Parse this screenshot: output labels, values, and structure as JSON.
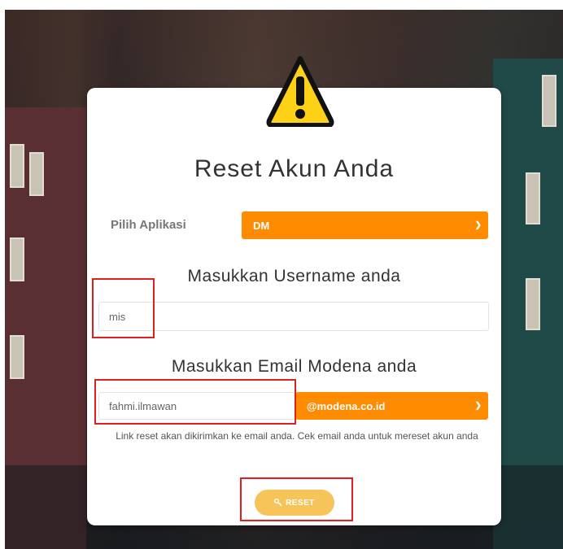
{
  "page": {
    "title": "Reset Akun Anda"
  },
  "app_select": {
    "label": "Pilih Aplikasi",
    "value": "DM"
  },
  "username": {
    "heading": "Masukkan Username anda",
    "value": "mis"
  },
  "email": {
    "heading": "Masukkan Email Modena anda",
    "value": "fahmi.ilmawan",
    "domain": "@modena.co.id"
  },
  "hint": "Link reset akan dikirimkan ke email anda. Cek email anda untuk mereset akun anda",
  "reset_button": {
    "label": "RESET",
    "icon": "key-icon"
  },
  "colors": {
    "accent_orange": "#ff8c00",
    "button_yellow": "#f6c458",
    "warning_yellow": "#fcd116",
    "highlight_red": "#e0201f"
  }
}
